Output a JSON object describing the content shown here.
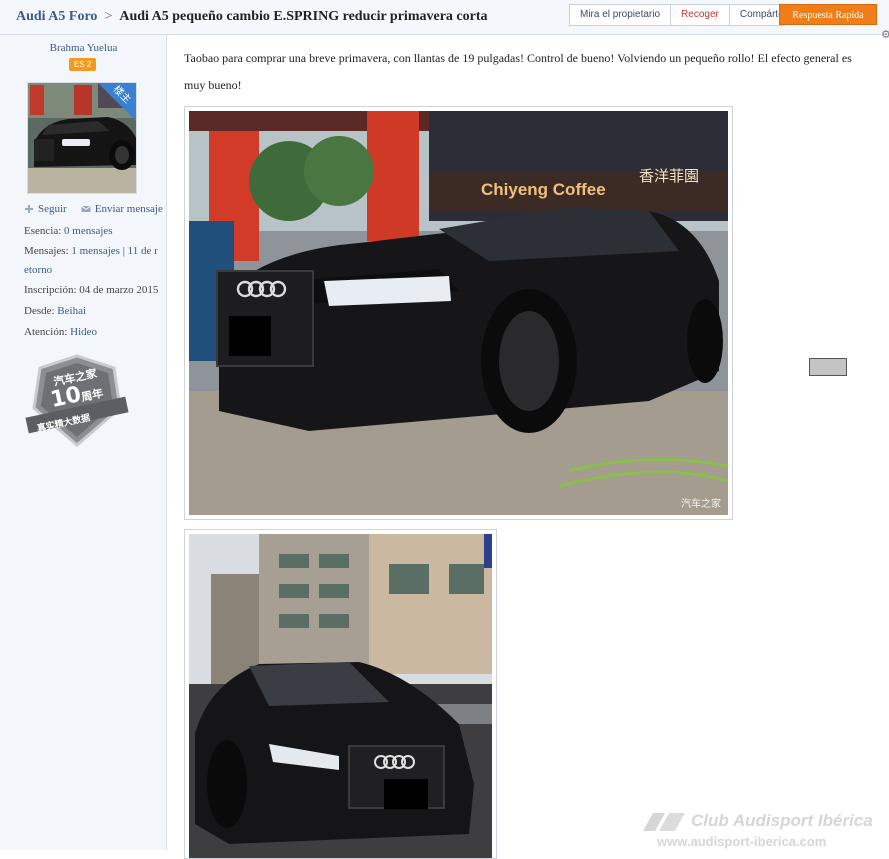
{
  "header": {
    "forum_link": "Audi A5 Foro",
    "separator": ">",
    "thread_title": "Audi A5 pequeño cambio E.SPRING reducir primavera corta",
    "actions": [
      "Mira el propietario",
      "Recoger",
      "Compártelo"
    ],
    "reply_button": "Respuesta Rapida"
  },
  "author": {
    "name": "Brahma Yuelua",
    "level": "ES 2",
    "owner_tag": "楼主",
    "follow": "Seguir",
    "message": "Enviar mensaje",
    "essence_label": "Esencia:",
    "essence_value": "0 mensajes",
    "posts_label": "Mensajes:",
    "posts_value": "1 mensajes",
    "posts_extra": "11 de r",
    "posts_cont": "etorno",
    "joined_label": "Inscripción:",
    "joined_value": "04 de marzo 2015",
    "from_label": "Desde:",
    "from_value": "Beihai",
    "attention_label": "Atención:",
    "attention_value": "Hideo"
  },
  "badge": {
    "line1": "汽车之家",
    "line2": "10",
    "line3": "周年",
    "line4": "真实精大数据"
  },
  "post": {
    "text": "Taobao para comprar una breve primavera, con llantas de 19 pulgadas! Control de bueno! Volviendo un pequeño rollo! El efecto general es muy bueno!",
    "photo1_watermark": "汽车之家",
    "photo1_sign": "Chiyeng Coffee",
    "photo1_sign_cn": "香洋菲園"
  },
  "watermark": {
    "name": "Club Audisport Ibérica",
    "url": "www.audisport-iberica.com"
  },
  "colors": {
    "accent": "#ef7d1a",
    "link": "#3b5b8c",
    "sidebar_bg": "#f3f6fb"
  },
  "icons": {
    "follow": "plus-icon",
    "message": "envelope-icon"
  }
}
